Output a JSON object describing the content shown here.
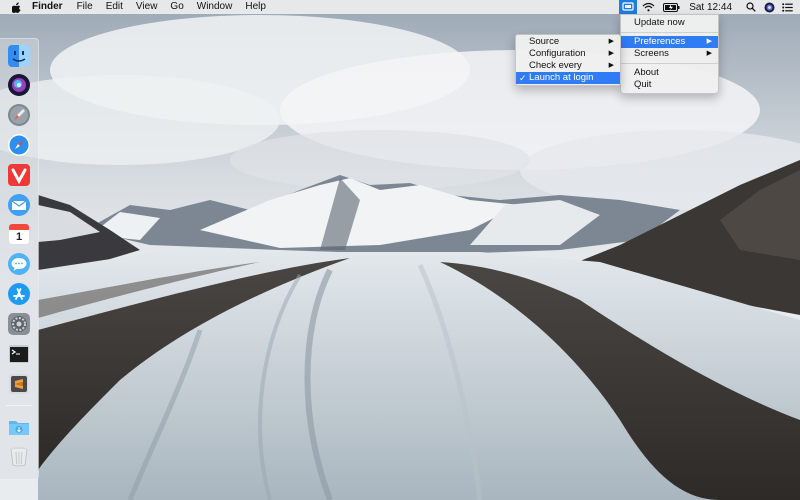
{
  "menubar": {
    "apple_icon": "apple-logo-icon",
    "app_name": "Finder",
    "menus": [
      "File",
      "Edit",
      "View",
      "Go",
      "Window",
      "Help"
    ],
    "status_icons": [
      "app-status-icon",
      "wifi-icon",
      "battery-icon",
      "search-icon",
      "siri-icon",
      "notification-center-icon"
    ],
    "clock": "Sat 12:44"
  },
  "app_menu": {
    "items": [
      "Update now",
      "Preferences",
      "Screens",
      "About",
      "Quit"
    ],
    "highlighted": "Preferences"
  },
  "preferences_submenu": {
    "items": [
      "Source",
      "Configuration",
      "Check every",
      "Launch at login"
    ],
    "checked": "Launch at login",
    "highlighted": "Launch at login",
    "check_mark": "✓"
  },
  "dock": {
    "apps": [
      "Finder",
      "Siri",
      "Launchpad",
      "Safari",
      "Vivaldi",
      "Mail",
      "Calendar",
      "Messages",
      "App Store",
      "System Preferences",
      "Terminal",
      "Sublime Text"
    ],
    "calendar_month": "JAN",
    "calendar_day": "1",
    "folders": [
      "Downloads",
      "Trash"
    ]
  },
  "colors": {
    "menu_highlight": "#2f7cf6",
    "status_active": "#1e7de0"
  }
}
